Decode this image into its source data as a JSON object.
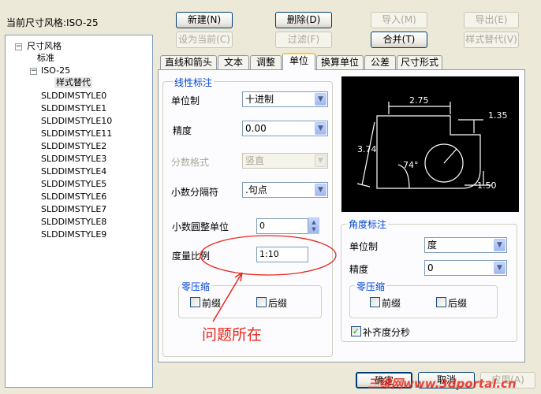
{
  "header": {
    "current_style_label": "当前尺寸风格:ISO-25"
  },
  "toolbar": {
    "new_label": "新建(N)",
    "delete_label": "删除(D)",
    "import_label": "导入(M)",
    "export_label": "导出(E)",
    "set_current_label": "设为当前(C)",
    "filter_label": "过滤(F)",
    "merge_label": "合并(T)",
    "style_override_label": "样式替代(V)"
  },
  "tree": {
    "root_label": "尺寸风格",
    "root_toggle": "−",
    "standard_label": "标准",
    "iso_label": "ISO-25",
    "iso_toggle": "−",
    "override_label": "样式替代",
    "styles": [
      "SLDDIMSTYLE0",
      "SLDDIMSTYLE1",
      "SLDDIMSTYLE10",
      "SLDDIMSTYLE11",
      "SLDDIMSTYLE2",
      "SLDDIMSTYLE3",
      "SLDDIMSTYLE4",
      "SLDDIMSTYLE5",
      "SLDDIMSTYLE6",
      "SLDDIMSTYLE7",
      "SLDDIMSTYLE8",
      "SLDDIMSTYLE9"
    ]
  },
  "tabs": [
    "直线和箭头",
    "文本",
    "调整",
    "单位",
    "换算单位",
    "公差",
    "尺寸形式"
  ],
  "active_tab": "单位",
  "linear": {
    "title": "线性标注",
    "unit_label": "单位制",
    "unit_value": "十进制",
    "precision_label": "精度",
    "precision_value": "0.00",
    "fraction_label": "分数格式",
    "fraction_value": "竖直",
    "decimal_sep_label": "小数分隔符",
    "decimal_sep_value": ".句点",
    "round_label": "小数圆整单位",
    "round_value": "0",
    "scale_label": "度量比例",
    "scale_value": "1:10",
    "zero_title": "零压缩",
    "leading_label": "前缀",
    "trailing_label": "后缀"
  },
  "preview": {
    "dim_275": "2.75",
    "dim_135": "1.35",
    "dim_374": "3.74",
    "dim_150": "1.50",
    "angle": "74°"
  },
  "angular": {
    "title": "角度标注",
    "unit_label": "单位制",
    "unit_value": "度",
    "precision_label": "精度",
    "precision_value": "0",
    "zero_title": "零压缩",
    "leading_label": "前缀",
    "trailing_label": "后缀",
    "pad_label": "补齐度分秒",
    "pad_checked": "✓"
  },
  "annotation": {
    "text": "问题所在"
  },
  "footer": {
    "ok_label": "确定",
    "cancel_label": "取消",
    "apply_label": "应用(A)"
  },
  "watermark": {
    "text": "三维网www.3dportal.cn"
  },
  "colors": {
    "annotation_red": "#e8281e",
    "group_title_blue": "#0046d5",
    "preview_bg": "#000000"
  }
}
